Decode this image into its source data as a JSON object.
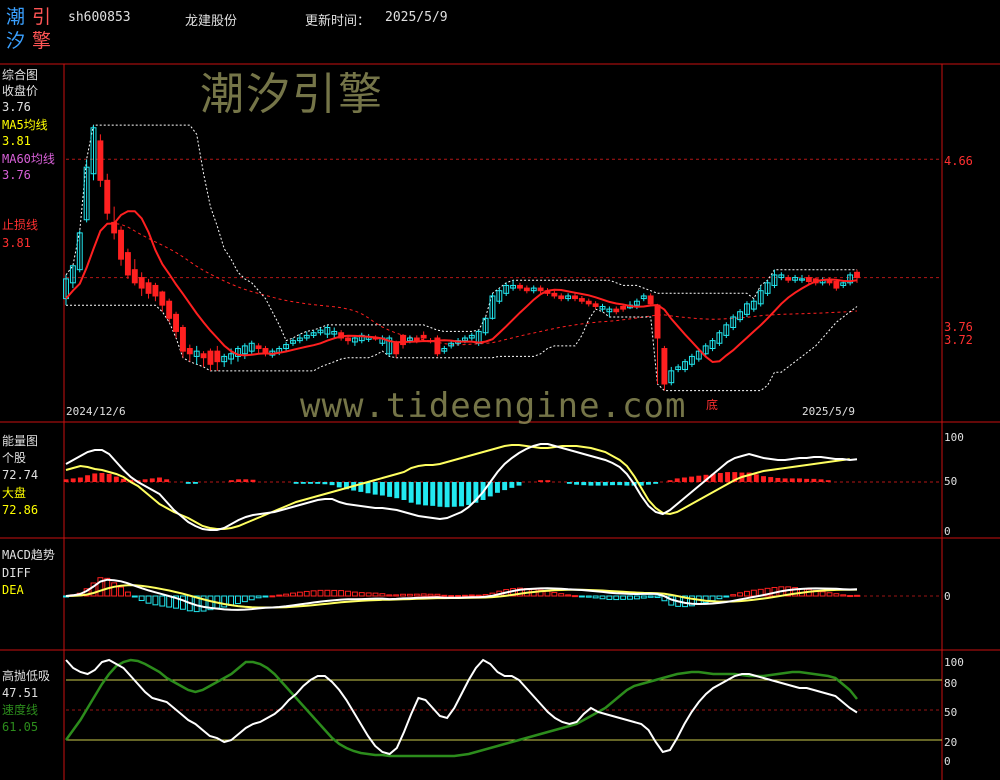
{
  "header": {
    "logo_chars": [
      "潮",
      "引",
      "汐",
      "擎"
    ],
    "code": "sh600853",
    "name": "龙建股份",
    "update_label": "更新时间：",
    "update_date": "2025/5/9"
  },
  "watermarks": {
    "cn": "潮汐引擎",
    "url": "www.tideengine.com"
  },
  "panels": {
    "main": {
      "title": "综合图",
      "close_label": "收盘价",
      "close_value": "3.76",
      "ma5_label": "MA5均线",
      "ma5_value": "3.81",
      "ma60_label": "MA60均线",
      "ma60_value": "3.76",
      "stop_label": "止损线",
      "stop_value": "3.81",
      "date_start": "2024/12/6",
      "date_end": "2025/5/9",
      "right_labels": [
        "4.66",
        "3.76",
        "3.72"
      ],
      "low_mark": "底"
    },
    "energy": {
      "title": "能量图",
      "stock_label": "个股",
      "stock_value": "72.74",
      "market_label": "大盘",
      "market_value": "72.86",
      "right_labels": [
        "100",
        "50",
        "0"
      ]
    },
    "macd": {
      "title": "MACD趋势",
      "diff_label": "DIFF",
      "dea_label": "DEA",
      "right_labels": [
        "0"
      ]
    },
    "gaodi": {
      "title": "高抛低吸",
      "value": "47.51",
      "speed_label": "速度线",
      "speed_value": "61.05",
      "right_labels": [
        "100",
        "80",
        "50",
        "20",
        "0"
      ]
    }
  },
  "colors": {
    "up": "#ff2020",
    "down": "#22e8f0",
    "ma5": "#ff2020",
    "ma60": "#ff2020",
    "white": "#ffffff",
    "yellow": "#ffff60",
    "green": "#2c8c1c",
    "grid": "#c81010",
    "label_white": "#e0e0e0",
    "label_yellow": "#ffff00",
    "label_red": "#ff3030",
    "label_purple": "#d860d8"
  },
  "chart_data": [
    {
      "type": "candlestick",
      "panel": "综合图",
      "yticks": [
        4.66,
        3.76,
        3.72
      ],
      "dates": [
        "2024/12/6",
        "2025/5/9"
      ],
      "candles": [
        [
          3.75,
          3.6,
          3.78,
          3.55
        ],
        [
          3.85,
          3.72,
          3.85,
          3.68
        ],
        [
          4.1,
          3.82,
          4.12,
          3.8
        ],
        [
          4.6,
          4.2,
          4.66,
          4.18
        ],
        [
          4.9,
          4.55,
          4.92,
          4.5
        ],
        [
          4.5,
          4.8,
          4.85,
          4.45
        ],
        [
          4.25,
          4.5,
          4.55,
          4.2
        ],
        [
          4.1,
          4.18,
          4.3,
          4.05
        ],
        [
          3.9,
          4.12,
          4.15,
          3.85
        ],
        [
          3.78,
          3.95,
          3.98,
          3.75
        ],
        [
          3.72,
          3.82,
          3.9,
          3.7
        ],
        [
          3.68,
          3.76,
          3.8,
          3.62
        ],
        [
          3.64,
          3.72,
          3.75,
          3.6
        ],
        [
          3.62,
          3.7,
          3.72,
          3.58
        ],
        [
          3.55,
          3.65,
          3.66,
          3.5
        ],
        [
          3.45,
          3.58,
          3.6,
          3.42
        ],
        [
          3.35,
          3.48,
          3.5,
          3.3
        ],
        [
          3.2,
          3.38,
          3.4,
          3.15
        ],
        [
          3.18,
          3.22,
          3.25,
          3.12
        ],
        [
          3.2,
          3.16,
          3.24,
          3.1
        ],
        [
          3.15,
          3.18,
          3.2,
          3.08
        ],
        [
          3.1,
          3.2,
          3.22,
          3.05
        ],
        [
          3.12,
          3.2,
          3.24,
          3.05
        ],
        [
          3.16,
          3.12,
          3.18,
          3.08
        ],
        [
          3.18,
          3.14,
          3.22,
          3.1
        ],
        [
          3.22,
          3.16,
          3.24,
          3.12
        ],
        [
          3.24,
          3.18,
          3.26,
          3.14
        ],
        [
          3.26,
          3.2,
          3.28,
          3.18
        ],
        [
          3.22,
          3.24,
          3.26,
          3.18
        ],
        [
          3.18,
          3.22,
          3.24,
          3.16
        ],
        [
          3.2,
          3.17,
          3.22,
          3.15
        ],
        [
          3.22,
          3.19,
          3.24,
          3.17
        ],
        [
          3.25,
          3.22,
          3.27,
          3.2
        ],
        [
          3.28,
          3.26,
          3.3,
          3.24
        ],
        [
          3.3,
          3.28,
          3.33,
          3.26
        ],
        [
          3.32,
          3.3,
          3.35,
          3.28
        ],
        [
          3.34,
          3.32,
          3.36,
          3.3
        ],
        [
          3.36,
          3.34,
          3.38,
          3.32
        ],
        [
          3.38,
          3.33,
          3.4,
          3.3
        ],
        [
          3.35,
          3.33,
          3.38,
          3.3
        ],
        [
          3.3,
          3.34,
          3.36,
          3.28
        ],
        [
          3.28,
          3.3,
          3.32,
          3.25
        ],
        [
          3.3,
          3.27,
          3.32,
          3.24
        ],
        [
          3.32,
          3.28,
          3.34,
          3.26
        ],
        [
          3.31,
          3.29,
          3.33,
          3.27
        ],
        [
          3.3,
          3.3,
          3.32,
          3.28
        ],
        [
          3.3,
          3.26,
          3.32,
          3.24
        ],
        [
          3.3,
          3.18,
          3.32,
          3.16
        ],
        [
          3.18,
          3.26,
          3.28,
          3.15
        ],
        [
          3.25,
          3.32,
          3.33,
          3.22
        ],
        [
          3.3,
          3.28,
          3.32,
          3.26
        ],
        [
          3.28,
          3.3,
          3.32,
          3.26
        ],
        [
          3.3,
          3.32,
          3.35,
          3.28
        ],
        [
          3.28,
          3.28,
          3.3,
          3.26
        ],
        [
          3.18,
          3.3,
          3.32,
          3.16
        ],
        [
          3.22,
          3.2,
          3.24,
          3.18
        ],
        [
          3.26,
          3.24,
          3.28,
          3.22
        ],
        [
          3.28,
          3.26,
          3.3,
          3.24
        ],
        [
          3.3,
          3.28,
          3.32,
          3.26
        ],
        [
          3.32,
          3.3,
          3.34,
          3.28
        ],
        [
          3.35,
          3.26,
          3.36,
          3.24
        ],
        [
          3.45,
          3.34,
          3.46,
          3.32
        ],
        [
          3.62,
          3.45,
          3.64,
          3.44
        ],
        [
          3.66,
          3.58,
          3.68,
          3.56
        ],
        [
          3.7,
          3.64,
          3.72,
          3.62
        ],
        [
          3.7,
          3.68,
          3.74,
          3.66
        ],
        [
          3.68,
          3.7,
          3.72,
          3.66
        ],
        [
          3.66,
          3.68,
          3.7,
          3.64
        ],
        [
          3.68,
          3.66,
          3.7,
          3.64
        ],
        [
          3.66,
          3.68,
          3.7,
          3.64
        ],
        [
          3.64,
          3.66,
          3.68,
          3.62
        ],
        [
          3.62,
          3.64,
          3.66,
          3.6
        ],
        [
          3.6,
          3.62,
          3.64,
          3.58
        ],
        [
          3.62,
          3.6,
          3.64,
          3.58
        ],
        [
          3.6,
          3.62,
          3.64,
          3.58
        ],
        [
          3.58,
          3.6,
          3.62,
          3.56
        ],
        [
          3.56,
          3.58,
          3.6,
          3.54
        ],
        [
          3.54,
          3.56,
          3.58,
          3.52
        ],
        [
          3.54,
          3.52,
          3.56,
          3.5
        ],
        [
          3.52,
          3.5,
          3.54,
          3.46
        ],
        [
          3.5,
          3.52,
          3.54,
          3.48
        ],
        [
          3.52,
          3.54,
          3.56,
          3.5
        ],
        [
          3.55,
          3.53,
          3.58,
          3.52
        ],
        [
          3.58,
          3.55,
          3.6,
          3.52
        ],
        [
          3.62,
          3.6,
          3.64,
          3.58
        ],
        [
          3.56,
          3.62,
          3.64,
          3.54
        ],
        [
          3.3,
          3.55,
          3.56,
          2.95
        ],
        [
          2.95,
          3.22,
          3.24,
          2.9
        ],
        [
          3.05,
          2.96,
          3.08,
          2.94
        ],
        [
          3.08,
          3.06,
          3.1,
          3.04
        ],
        [
          3.12,
          3.06,
          3.14,
          3.04
        ],
        [
          3.16,
          3.1,
          3.18,
          3.08
        ],
        [
          3.2,
          3.14,
          3.22,
          3.12
        ],
        [
          3.24,
          3.18,
          3.26,
          3.16
        ],
        [
          3.28,
          3.22,
          3.3,
          3.2
        ],
        [
          3.34,
          3.26,
          3.36,
          3.24
        ],
        [
          3.4,
          3.32,
          3.42,
          3.3
        ],
        [
          3.46,
          3.38,
          3.48,
          3.36
        ],
        [
          3.5,
          3.44,
          3.52,
          3.42
        ],
        [
          3.56,
          3.48,
          3.58,
          3.46
        ],
        [
          3.58,
          3.52,
          3.6,
          3.5
        ],
        [
          3.66,
          3.56,
          3.7,
          3.54
        ],
        [
          3.72,
          3.64,
          3.74,
          3.62
        ],
        [
          3.78,
          3.7,
          3.82,
          3.68
        ],
        [
          3.78,
          3.76,
          3.8,
          3.74
        ],
        [
          3.74,
          3.76,
          3.78,
          3.72
        ],
        [
          3.76,
          3.74,
          3.78,
          3.72
        ],
        [
          3.75,
          3.74,
          3.78,
          3.72
        ],
        [
          3.73,
          3.76,
          3.78,
          3.71
        ],
        [
          3.72,
          3.75,
          3.76,
          3.7
        ],
        [
          3.74,
          3.72,
          3.76,
          3.7
        ],
        [
          3.72,
          3.74,
          3.76,
          3.7
        ],
        [
          3.68,
          3.73,
          3.75,
          3.66
        ],
        [
          3.72,
          3.7,
          3.74,
          3.68
        ],
        [
          3.78,
          3.72,
          3.8,
          3.7
        ],
        [
          3.76,
          3.8,
          3.82,
          3.72
        ]
      ]
    },
    {
      "type": "line",
      "panel": "能量图",
      "ylim": [
        0,
        100
      ],
      "series": [
        {
          "name": "个股",
          "values": [
            68,
            72,
            76,
            80,
            82,
            82,
            78,
            70,
            62,
            55,
            50,
            46,
            42,
            38,
            30,
            22,
            16,
            10,
            6,
            3,
            2,
            2,
            4,
            8,
            12,
            15,
            17,
            18,
            19,
            20,
            22,
            24,
            26,
            28,
            30,
            32,
            33,
            33,
            30,
            28,
            27,
            26,
            25,
            24,
            24,
            23,
            22,
            20,
            18,
            16,
            15,
            14,
            13,
            14,
            17,
            20,
            25,
            32,
            40,
            50,
            60,
            68,
            74,
            79,
            83,
            86,
            88,
            88,
            86,
            84,
            82,
            80,
            78,
            76,
            74,
            72,
            69,
            65,
            58,
            48,
            36,
            26,
            20,
            18,
            22,
            28,
            34,
            40,
            46,
            52,
            58,
            64,
            70,
            74,
            76,
            78,
            76,
            74,
            73,
            72,
            72,
            73,
            74,
            74,
            75,
            75,
            74,
            73,
            73,
            72,
            72.74
          ]
        },
        {
          "name": "大盘",
          "values": [
            62,
            64,
            66,
            65,
            63,
            62,
            60,
            58,
            55,
            50,
            46,
            40,
            34,
            28,
            24,
            20,
            17,
            14,
            10,
            6,
            4,
            3,
            3,
            4,
            6,
            9,
            12,
            15,
            18,
            21,
            24,
            27,
            30,
            32,
            34,
            36,
            38,
            40,
            42,
            44,
            46,
            48,
            50,
            52,
            54,
            56,
            58,
            60,
            64,
            66,
            67,
            67,
            68,
            70,
            72,
            74,
            76,
            78,
            80,
            82,
            84,
            86,
            87,
            87,
            86,
            85,
            84,
            84,
            85,
            86,
            86,
            86,
            85,
            84,
            82,
            80,
            76,
            72,
            66,
            56,
            44,
            32,
            24,
            19,
            18,
            20,
            24,
            28,
            32,
            36,
            40,
            44,
            48,
            52,
            55,
            57,
            59,
            61,
            62,
            63,
            64,
            65,
            66,
            67,
            68,
            69,
            70,
            71,
            72,
            72.86
          ]
        }
      ]
    },
    {
      "type": "bar+line",
      "panel": "MACD趋势",
      "series": [
        {
          "name": "DIFF"
        },
        {
          "name": "DEA"
        }
      ]
    },
    {
      "type": "line",
      "panel": "高抛低吸",
      "ylim": [
        0,
        100
      ],
      "yticks": [
        100,
        80,
        50,
        20,
        0
      ],
      "series": [
        {
          "name": "高抛低吸",
          "values": [
            100,
            92,
            88,
            86,
            90,
            98,
            100,
            96,
            92,
            84,
            76,
            68,
            62,
            60,
            58,
            52,
            46,
            40,
            36,
            30,
            24,
            22,
            18,
            20,
            26,
            32,
            36,
            38,
            42,
            46,
            52,
            60,
            66,
            74,
            80,
            84,
            84,
            78,
            70,
            60,
            48,
            36,
            24,
            14,
            8,
            6,
            12,
            28,
            46,
            62,
            60,
            52,
            44,
            42,
            52,
            66,
            80,
            92,
            100,
            96,
            88,
            84,
            84,
            80,
            72,
            64,
            56,
            48,
            42,
            38,
            36,
            38,
            46,
            52,
            48,
            46,
            44,
            42,
            40,
            38,
            36,
            30,
            18,
            8,
            10,
            22,
            36,
            48,
            58,
            66,
            72,
            76,
            80,
            84,
            86,
            86,
            84,
            82,
            80,
            78,
            76,
            74,
            72,
            72,
            70,
            68,
            66,
            64,
            58,
            52,
            47.51
          ]
        },
        {
          "name": "速度线",
          "values": [
            20,
            30,
            40,
            52,
            64,
            76,
            86,
            94,
            98,
            100,
            99,
            96,
            92,
            88,
            82,
            78,
            74,
            70,
            68,
            70,
            74,
            78,
            82,
            86,
            92,
            98,
            98,
            96,
            92,
            86,
            78,
            70,
            62,
            54,
            46,
            38,
            30,
            22,
            16,
            12,
            9,
            7,
            6,
            5,
            5,
            4,
            4,
            4,
            4,
            4,
            4,
            4,
            4,
            4,
            4,
            5,
            6,
            8,
            10,
            12,
            14,
            16,
            18,
            20,
            22,
            24,
            26,
            28,
            30,
            32,
            34,
            36,
            40,
            44,
            48,
            52,
            58,
            64,
            70,
            74,
            76,
            78,
            80,
            82,
            84,
            86,
            87,
            88,
            88,
            87,
            86,
            86,
            86,
            86,
            85,
            84,
            84,
            84,
            85,
            86,
            87,
            88,
            88,
            87,
            86,
            85,
            84,
            82,
            76,
            70,
            61.05
          ]
        }
      ]
    }
  ]
}
